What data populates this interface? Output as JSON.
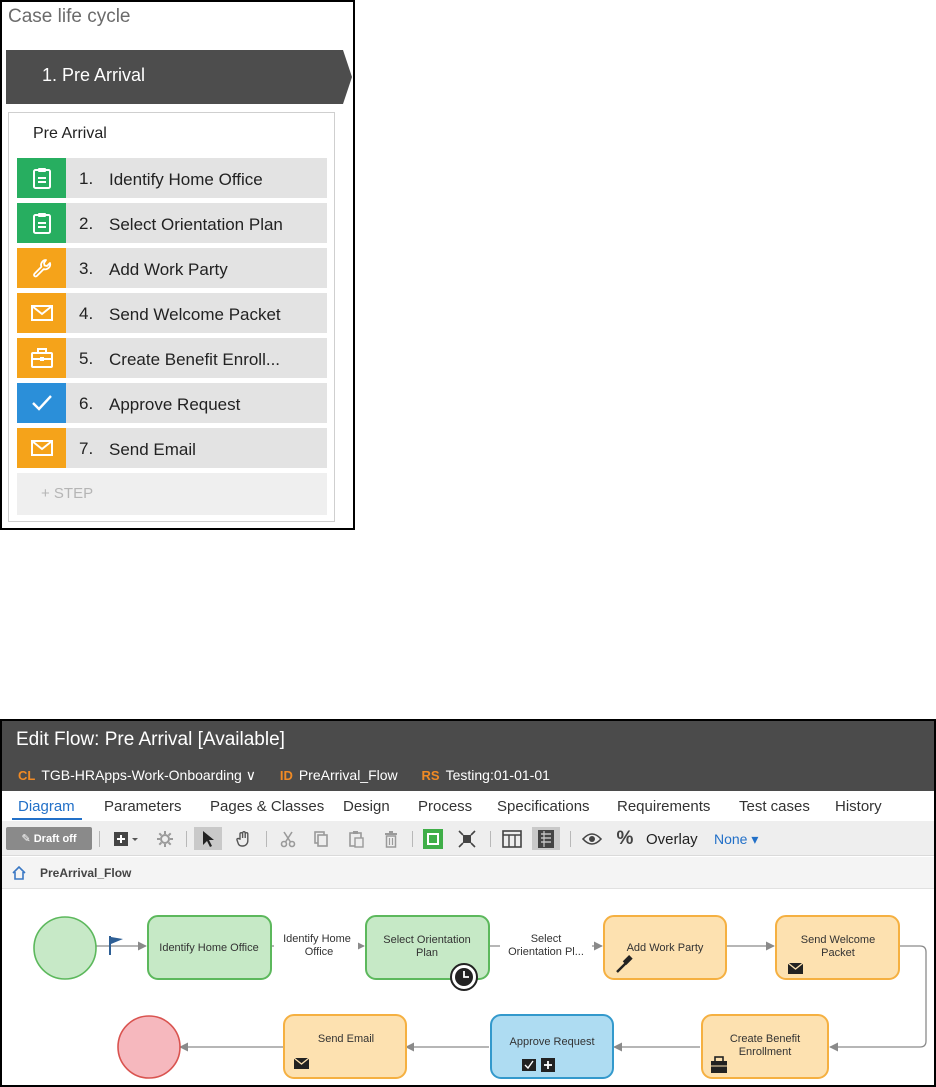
{
  "lifecycle": {
    "title": "Case life cycle",
    "stage_label": "1.  Pre Arrival",
    "stage_box_title": "Pre Arrival",
    "steps": [
      {
        "num": "1.",
        "label": "Identify Home Office",
        "icon": "clipboard-icon",
        "color": "#27ae60"
      },
      {
        "num": "2.",
        "label": "Select Orientation Plan",
        "icon": "clipboard-icon",
        "color": "#27ae60"
      },
      {
        "num": "3.",
        "label": "Add Work Party",
        "icon": "wrench-icon",
        "color": "#f5a31a"
      },
      {
        "num": "4.",
        "label": "Send Welcome Packet",
        "icon": "envelope-icon",
        "color": "#f5a31a"
      },
      {
        "num": "5.",
        "label": "Create Benefit Enroll...",
        "icon": "briefcase-icon",
        "color": "#f5a31a"
      },
      {
        "num": "6.",
        "label": "Approve Request",
        "icon": "checkmark-icon",
        "color": "#2b8fd9"
      },
      {
        "num": "7.",
        "label": "Send Email",
        "icon": "envelope-icon",
        "color": "#f5a31a"
      }
    ],
    "add_step_label": "+ STEP"
  },
  "editor": {
    "title": "Edit Flow: Pre Arrival [Available]",
    "meta": {
      "cl_key": "CL",
      "cl_value": "TGB-HRApps-Work-Onboarding ∨",
      "id_key": "ID",
      "id_value": "PreArrival_Flow",
      "rs_key": "RS",
      "rs_value": "Testing:01-01-01"
    },
    "tabs": [
      "Diagram",
      "Parameters",
      "Pages & Classes",
      "Design",
      "Process",
      "Specifications",
      "Requirements",
      "Test cases",
      "History"
    ],
    "toolbar": {
      "draft_label": "✎ Draft off",
      "percent_label": "%",
      "overlay_label": "Overlay",
      "overlay_value": "None ▾"
    },
    "breadcrumb": "PreArrival_Flow",
    "flow": {
      "shapes": [
        {
          "label": "Identify Home Office",
          "kind": "assignment"
        },
        {
          "label": "Select Orientation Plan",
          "kind": "assignment"
        },
        {
          "label": "Add Work Party",
          "kind": "utility"
        },
        {
          "label": "Send Welcome Packet",
          "kind": "utility"
        },
        {
          "label": "Create Benefit Enrollment",
          "kind": "utility"
        },
        {
          "label": "Approve Request",
          "kind": "approval"
        },
        {
          "label": "Send Email",
          "kind": "utility"
        }
      ],
      "connectors": [
        "Identify Home Office",
        "Select Orientation Pl..."
      ],
      "colors": {
        "assignment_fill": "#c6e9c6",
        "assignment_stroke": "#5cb85c",
        "utility_fill": "#fde1b0",
        "utility_stroke": "#f5b041",
        "approval_fill": "#aedcf2",
        "approval_stroke": "#3399cc",
        "start_fill": "#c7e9c7",
        "end_fill": "#f6b8be"
      }
    }
  }
}
